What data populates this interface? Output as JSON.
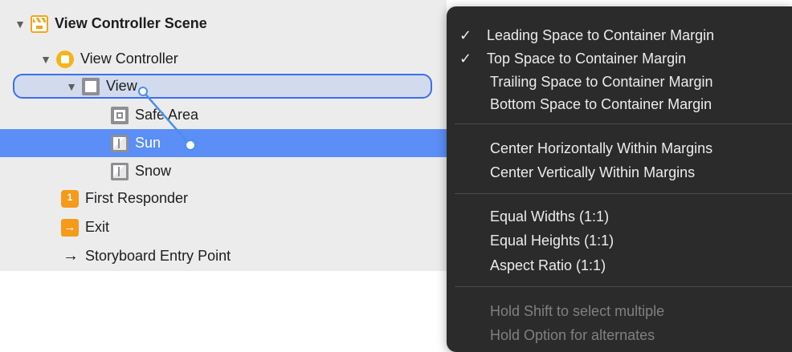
{
  "outline": {
    "rows": [
      {
        "label": "View Controller Scene"
      },
      {
        "label": "View Controller"
      },
      {
        "label": "View"
      },
      {
        "label": "Safe Area"
      },
      {
        "label": "Sun"
      },
      {
        "label": "Snow"
      },
      {
        "label": "First Responder"
      },
      {
        "label": "Exit"
      },
      {
        "label": "Storyboard Entry Point"
      }
    ]
  },
  "menu": {
    "check_glyph": "✓",
    "group1": [
      {
        "label": "Leading Space to Container Margin",
        "checked": true
      },
      {
        "label": "Top Space to Container Margin",
        "checked": true
      },
      {
        "label": "Trailing Space to Container Margin",
        "checked": false
      },
      {
        "label": "Bottom Space to Container Margin",
        "checked": false
      }
    ],
    "group2": [
      {
        "label": "Center Horizontally Within Margins"
      },
      {
        "label": "Center Vertically Within Margins"
      }
    ],
    "group3": [
      {
        "label": "Equal Widths (1:1)"
      },
      {
        "label": "Equal Heights (1:1)"
      },
      {
        "label": "Aspect Ratio (1:1)"
      }
    ],
    "hints": [
      {
        "label": "Hold Shift to select multiple"
      },
      {
        "label": "Hold Option for alternates"
      }
    ]
  },
  "colors": {
    "selection": "#5b8ef6",
    "drag_line": "#4b8fe8",
    "menu_bg": "#2b2b2b",
    "scene_accent": "#f3a51a"
  }
}
